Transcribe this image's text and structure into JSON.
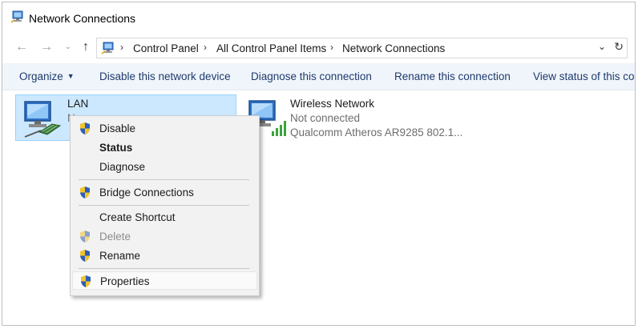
{
  "window": {
    "title": "Network Connections"
  },
  "nav": {
    "back_icon": "back-arrow-icon",
    "forward_icon": "forward-arrow-icon",
    "recent_icon": "chevron-down-icon",
    "up_icon": "up-arrow-icon"
  },
  "address": {
    "breadcrumbs": [
      "Control Panel",
      "All Control Panel Items",
      "Network Connections"
    ]
  },
  "toolbar": {
    "organize": "Organize",
    "disable": "Disable this network device",
    "diagnose": "Diagnose this connection",
    "rename": "Rename this connection",
    "view_status": "View status of this connection"
  },
  "connections": [
    {
      "name": "LAN",
      "status": "N",
      "selected": true
    },
    {
      "name": "Wireless Network",
      "status": "Not connected",
      "adapter": "Qualcomm Atheros AR9285 802.1..."
    }
  ],
  "context_menu": {
    "items": [
      {
        "label": "Disable",
        "shield": true,
        "bold": false,
        "enabled": true
      },
      {
        "label": "Status",
        "shield": false,
        "bold": true,
        "enabled": true
      },
      {
        "label": "Diagnose",
        "shield": false,
        "bold": false,
        "enabled": true
      },
      {
        "label": "Bridge Connections",
        "shield": true,
        "bold": false,
        "enabled": true
      },
      {
        "label": "Create Shortcut",
        "shield": false,
        "bold": false,
        "enabled": true
      },
      {
        "label": "Delete",
        "shield": true,
        "bold": false,
        "enabled": false
      },
      {
        "label": "Rename",
        "shield": true,
        "bold": false,
        "enabled": true
      },
      {
        "label": "Properties",
        "shield": true,
        "bold": false,
        "enabled": true,
        "highlighted": true
      }
    ]
  },
  "colors": {
    "selection_bg": "#cce8ff",
    "selection_border": "#99d1ff",
    "command_text": "#1e3a6b",
    "signal_green": "#3aa53a"
  }
}
